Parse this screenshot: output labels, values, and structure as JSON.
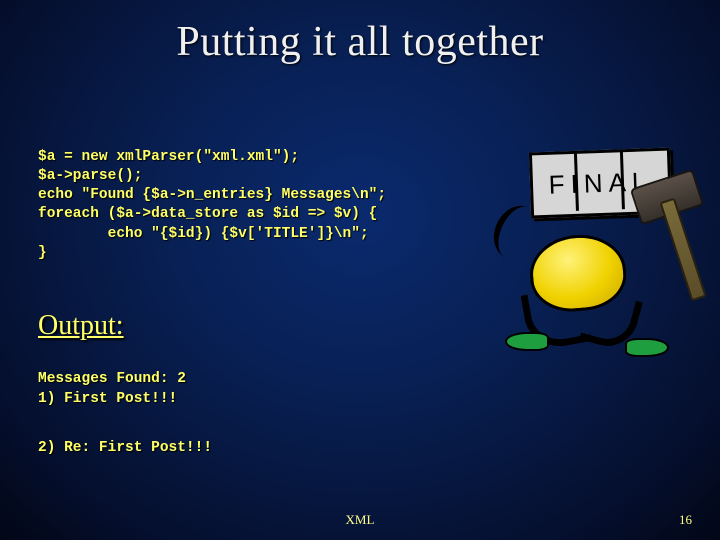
{
  "title": "Putting it all together",
  "code": {
    "l1": "$a = new xmlParser(\"xml.xml\");",
    "l2": "$a->parse();",
    "l3": "echo \"Found {$a->n_entries} Messages\\n\";",
    "l4": "foreach ($a->data_store as $id => $v) {",
    "l5": "        echo \"{$id}) {$v['TITLE']}\\n\";",
    "l6": "}"
  },
  "output_heading": "Output:",
  "output": {
    "l1": "Messages Found: 2",
    "l2": "1) First Post!!!",
    "l3": "2) Re: First Post!!!"
  },
  "illustration": {
    "sign_text": "FINAL"
  },
  "footer": {
    "label": "XML",
    "page": "16"
  }
}
